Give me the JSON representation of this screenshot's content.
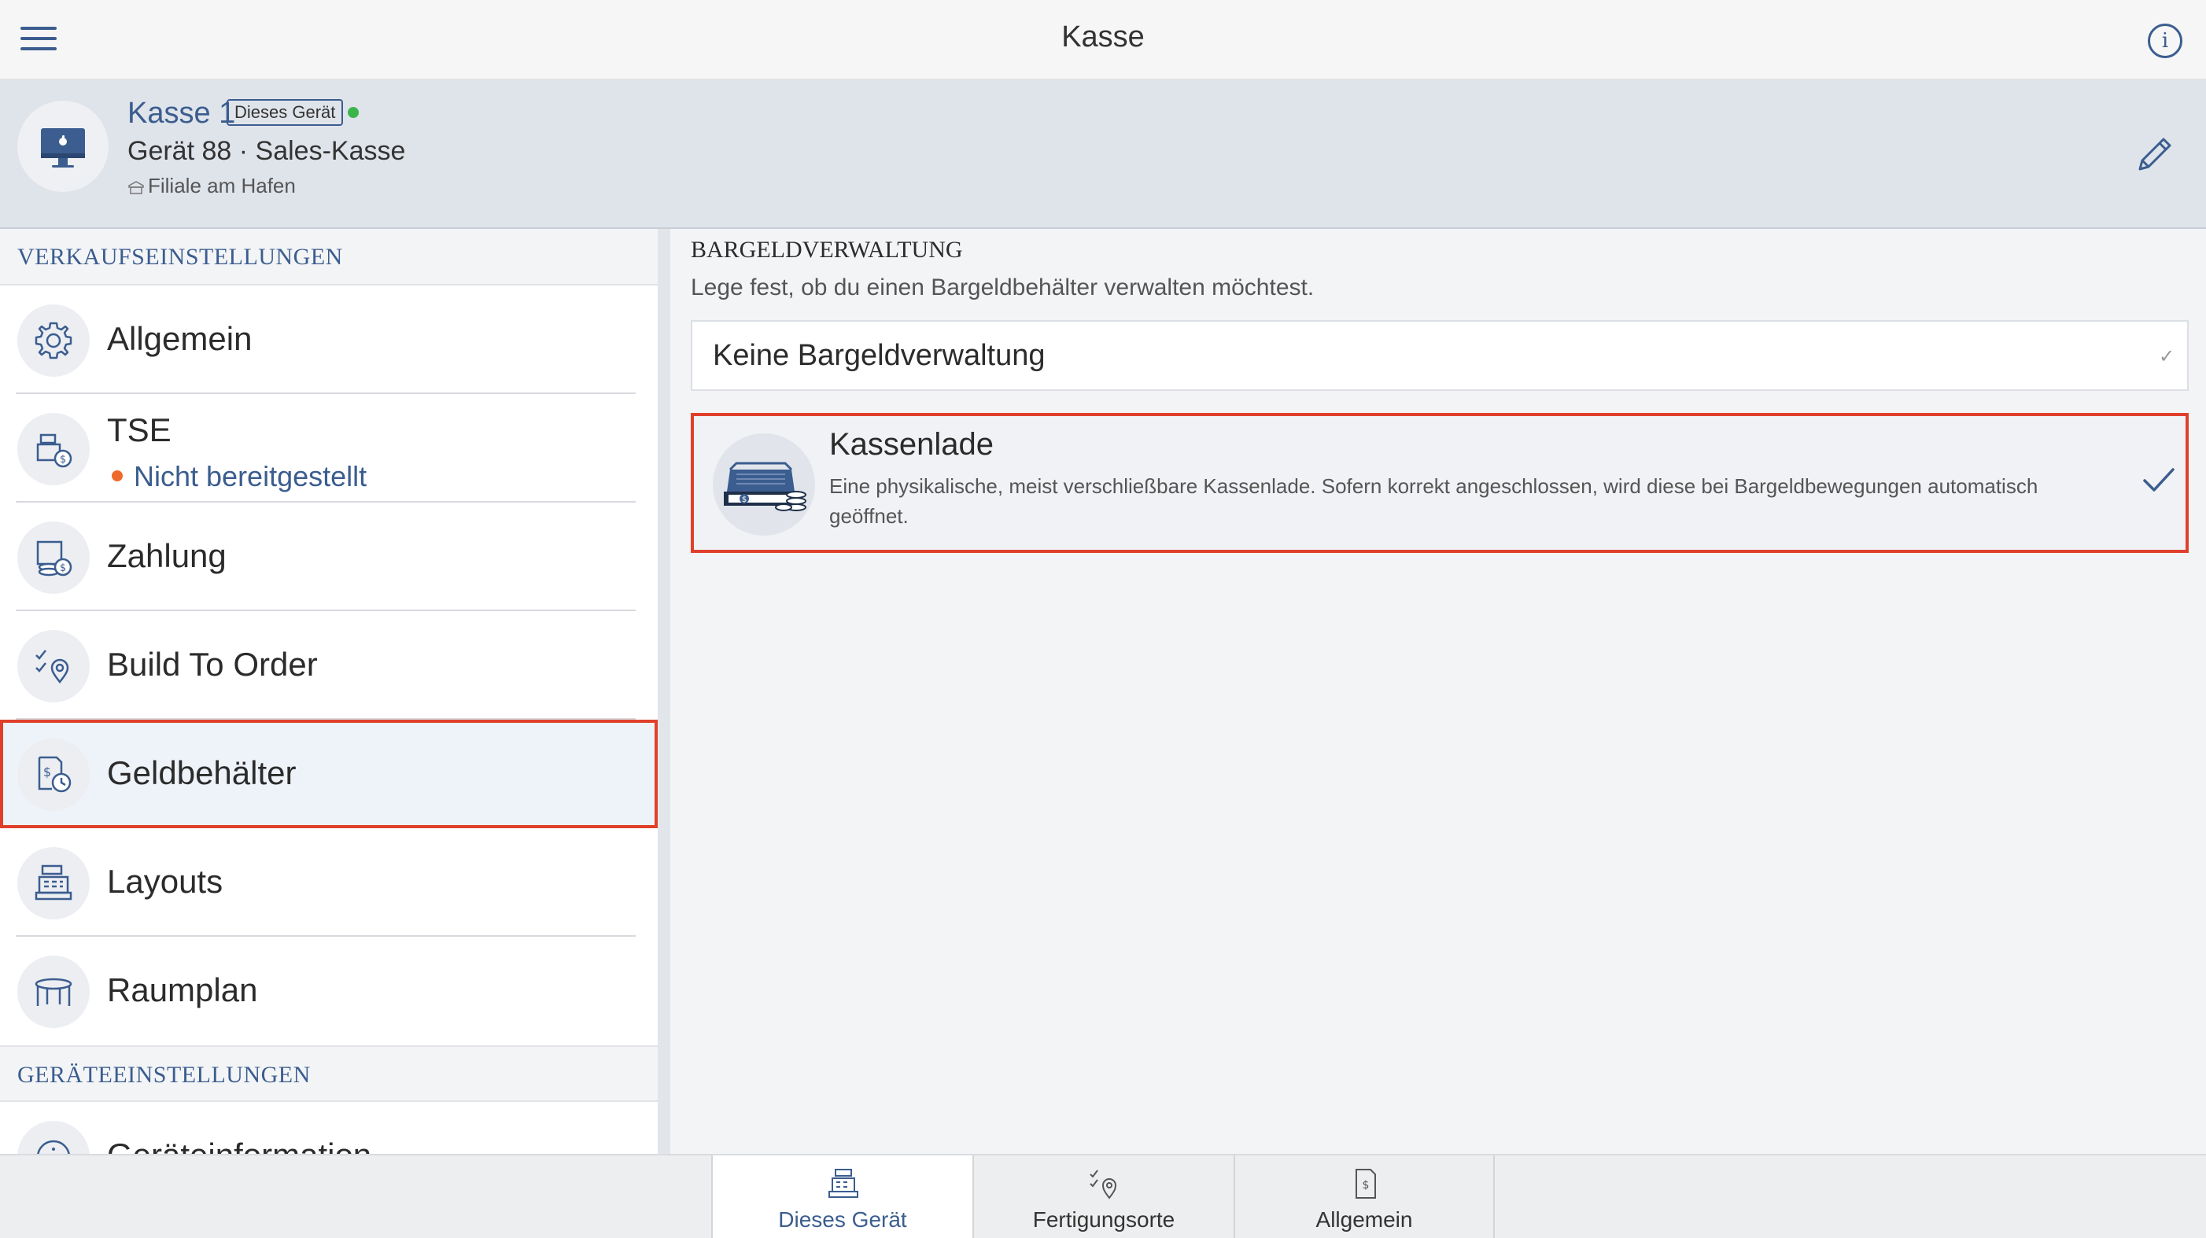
{
  "header": {
    "title": "Kasse",
    "menu_icon": "hamburger-icon",
    "info_icon": "info-icon"
  },
  "device": {
    "name": "Kasse 1",
    "badge": "Dieses Gerät",
    "status_color": "#3bb54a",
    "subtitle": "Gerät 88 · Sales-Kasse",
    "location": "Filiale am Hafen"
  },
  "sidebar": {
    "section_sales": "VERKAUFSEINSTELLUNGEN",
    "section_device": "GERÄTEEINSTELLUNGEN",
    "items": [
      {
        "label": "Allgemein",
        "icon": "gear-icon"
      },
      {
        "label": "TSE",
        "sublabel": "Nicht bereitgestellt",
        "icon": "register-coin-icon"
      },
      {
        "label": "Zahlung",
        "icon": "payment-coins-icon"
      },
      {
        "label": "Build To Order",
        "icon": "checklist-pin-icon"
      },
      {
        "label": "Geldbehälter",
        "icon": "money-clock-icon",
        "selected": true
      },
      {
        "label": "Layouts",
        "icon": "cash-register-icon"
      },
      {
        "label": "Raumplan",
        "icon": "table-icon"
      },
      {
        "label": "Geräteinformation",
        "icon": "info-circle-icon"
      }
    ]
  },
  "main": {
    "title": "BARGELDVERWALTUNG",
    "description": "Lege fest, ob du einen Bargeldbehälter verwalten möchtest.",
    "options": [
      {
        "label": "Keine Bargeldverwaltung",
        "check": "✓"
      },
      {
        "label": "Kassenlade",
        "description": "Eine physikalische, meist verschließbare Kassenlade. Sofern korrekt angeschlossen, wird diese bei Bargeldbewegungen automatisch geöffnet.",
        "selected": true
      }
    ]
  },
  "tabs": [
    {
      "label": "Dieses Gerät",
      "icon": "cash-register-icon",
      "active": true
    },
    {
      "label": "Fertigungsorte",
      "icon": "checklist-pin-icon"
    },
    {
      "label": "Allgemein",
      "icon": "document-dollar-icon"
    }
  ],
  "colors": {
    "accent": "#3b5d8f",
    "highlight": "#e0402b",
    "warning_dot": "#ee6a2a"
  }
}
